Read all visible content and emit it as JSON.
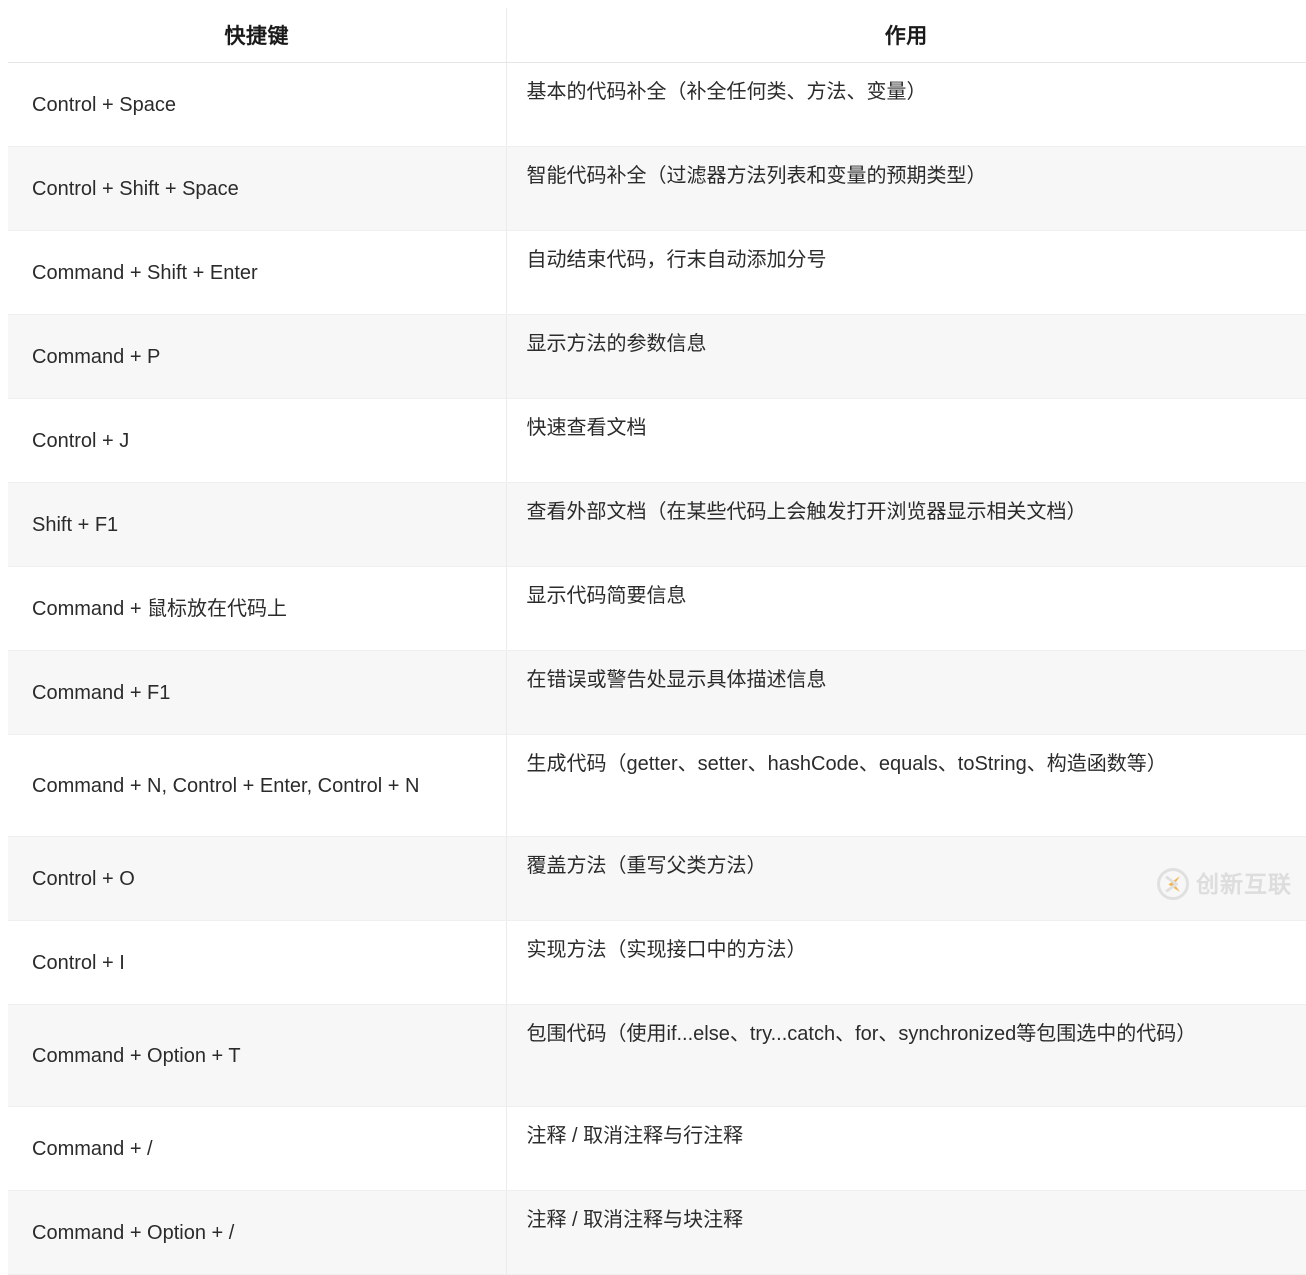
{
  "table": {
    "columns": [
      {
        "label": "快捷键"
      },
      {
        "label": "作用"
      }
    ],
    "rows": [
      {
        "key": "Control + Space",
        "desc": "基本的代码补全（补全任何类、方法、变量）"
      },
      {
        "key": "Control + Shift + Space",
        "desc": "智能代码补全（过滤器方法列表和变量的预期类型）"
      },
      {
        "key": "Command + Shift + Enter",
        "desc": "自动结束代码，行末自动添加分号"
      },
      {
        "key": "Command + P",
        "desc": "显示方法的参数信息"
      },
      {
        "key": "Control + J",
        "desc": "快速查看文档"
      },
      {
        "key": "Shift + F1",
        "desc": "查看外部文档（在某些代码上会触发打开浏览器显示相关文档）"
      },
      {
        "key": "Command + 鼠标放在代码上",
        "desc": "显示代码简要信息"
      },
      {
        "key": "Command + F1",
        "desc": "在错误或警告处显示具体描述信息"
      },
      {
        "key": "Command + N, Control + Enter, Control + N",
        "desc": "生成代码（getter、setter、hashCode、equals、toString、构造函数等）"
      },
      {
        "key": "Control + O",
        "desc": "覆盖方法（重写父类方法）"
      },
      {
        "key": "Control + I",
        "desc": "实现方法（实现接口中的方法）"
      },
      {
        "key": "Command + Option + T",
        "desc": "包围代码（使用if...else、try...catch、for、synchronized等包围选中的代码）"
      },
      {
        "key": "Command + /",
        "desc": "注释 / 取消注释与行注释"
      },
      {
        "key": "Command + Option + /",
        "desc": "注释 / 取消注释与块注释"
      }
    ]
  },
  "watermark": {
    "text": "创新互联",
    "logo_icon": "creative-link-logo-icon",
    "accent_color": "#f5a623",
    "text_color": "#d8d8d8"
  },
  "theme": {
    "page_background": "#ffffff",
    "row_stripe_color": "#f7f7f7",
    "border_color": "#ebebeb",
    "header_text_color": "#1a1a1a",
    "body_text_color": "#2b2b2b"
  }
}
